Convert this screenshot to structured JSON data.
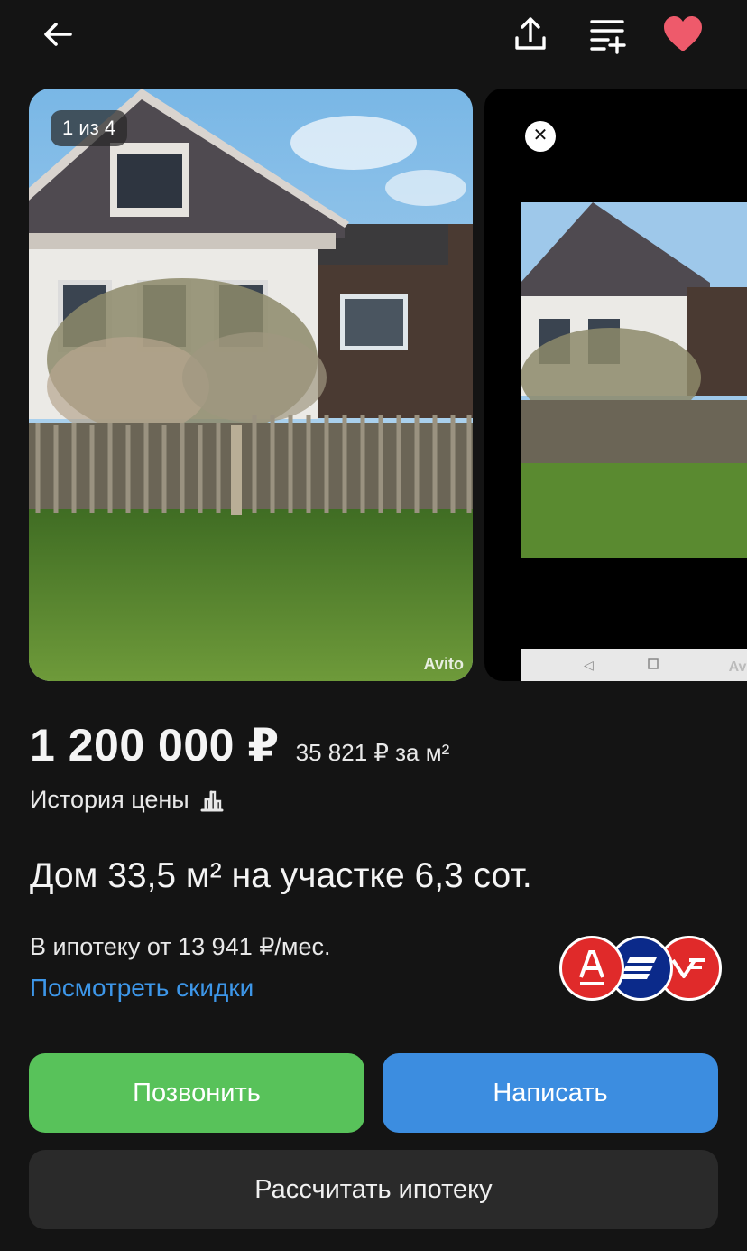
{
  "topbar": {
    "back_icon": "arrow-left-icon",
    "share_icon": "share-icon",
    "compare_icon": "add-to-compare-list-icon",
    "favorite_icon": "heart-icon",
    "favorite_color": "#ee5a6b"
  },
  "gallery": {
    "counter": "1 из 4",
    "watermark_main": "Avito",
    "close_icon": "close-icon",
    "second_photo_watermark": "Avito"
  },
  "listing": {
    "price": "1 200 000 ₽",
    "price_per_m2": "35 821 ₽ за м²",
    "price_history_label": "История цены",
    "price_history_icon": "bar-chart-icon",
    "title": "Дом 33,5 м² на участке 6,3 сот."
  },
  "mortgage": {
    "from_text": "В ипотеку от 13 941 ₽/мес.",
    "discounts_link": "Посмотреть скидки",
    "banks": [
      "alfa-bank-logo",
      "vtb-logo",
      "pochta-bank-logo"
    ]
  },
  "actions": {
    "call_label": "Позвонить",
    "write_label": "Написать",
    "calc_mortgage_label": "Рассчитать ипотеку",
    "call_color": "#58c25a",
    "write_color": "#3c8de0"
  }
}
